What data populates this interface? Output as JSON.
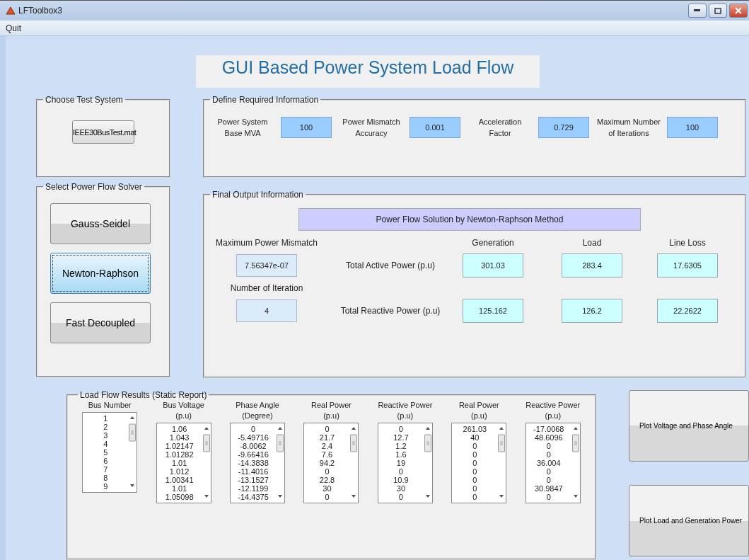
{
  "window": {
    "title": "LFToolbox3"
  },
  "menu": [
    "Quit"
  ],
  "heading": "GUI Based Power System Load Flow",
  "test_system": {
    "title": "Choose  Test System",
    "button": "IEEE30BusTest.mat"
  },
  "solver": {
    "title": "Select Power Flow Solver",
    "options": [
      {
        "label": "Gauss-Seidel",
        "selected": false
      },
      {
        "label": "Newton-Raphson",
        "selected": true
      },
      {
        "label": "Fast Decoupled",
        "selected": false
      }
    ]
  },
  "inputs": {
    "title": "Define Required Information",
    "fields": [
      {
        "label": "Power System Base MVA",
        "value": "100"
      },
      {
        "label": "Power Mismatch Accuracy",
        "value": "0.001"
      },
      {
        "label": "Acceleration Factor",
        "value": "0.729"
      },
      {
        "label": "Maximum Number of Iterations",
        "value": "100"
      }
    ]
  },
  "output": {
    "title": "Final Output Information",
    "banner": "Power Flow Solution by Newton-Raphson Method",
    "mismatch": {
      "label": "Maximum Power Mismatch",
      "value": "7.56347e-07"
    },
    "iterations": {
      "label": "Number of Iteration",
      "value": "4"
    },
    "columns": [
      "Generation",
      "Load",
      "Line Loss"
    ],
    "rows": [
      {
        "label": "Total Active Power (p.u)",
        "values": [
          "301.03",
          "283.4",
          "17.6305"
        ]
      },
      {
        "label": "Total Reactive Power (p.u)",
        "values": [
          "125.162",
          "126.2",
          "22.2622"
        ]
      }
    ]
  },
  "results": {
    "title": "Load Flow Results (Static Report)",
    "columns": [
      {
        "title": "Bus Number",
        "values": [
          "1",
          "2",
          "3",
          "4",
          "5",
          "6",
          "7",
          "8",
          "9"
        ]
      },
      {
        "title": "Bus Voltage",
        "unit": "(p.u)",
        "values": [
          "1.06",
          "1.043",
          "1.02147",
          "1.01282",
          "1.01",
          "1.012",
          "1.00341",
          "1.01",
          "1.05098"
        ]
      },
      {
        "title": "Phase Angle",
        "unit": "(Degree)",
        "values": [
          "0",
          "-5.49716",
          "-8.0062",
          "-9.66416",
          "-14.3838",
          "-11.4016",
          "-13.1527",
          "-12.1199",
          "-14.4375"
        ]
      },
      {
        "title": "Real  Power",
        "unit": "(p.u)",
        "values": [
          "0",
          "21.7",
          "2.4",
          "7.6",
          "94.2",
          "0",
          "22.8",
          "30",
          "0"
        ]
      },
      {
        "title": "Reactive  Power",
        "unit": "(p.u)",
        "values": [
          "0",
          "12.7",
          "1.2",
          "1.6",
          "19",
          "0",
          "10.9",
          "30",
          "0"
        ]
      },
      {
        "title": "Real Power",
        "unit": "(p.u)",
        "values": [
          "261.03",
          "40",
          "0",
          "0",
          "0",
          "0",
          "0",
          "0",
          "0"
        ]
      },
      {
        "title": "Reactive Power",
        "unit": "(p.u)",
        "values": [
          "-17.0068",
          "48.6096",
          "0",
          "0",
          "36.004",
          "0",
          "0",
          "30.9847",
          "0"
        ]
      }
    ]
  },
  "plot_buttons": [
    "Plot Voltage and Phase Angle",
    "Plot Load and Generation Power"
  ]
}
